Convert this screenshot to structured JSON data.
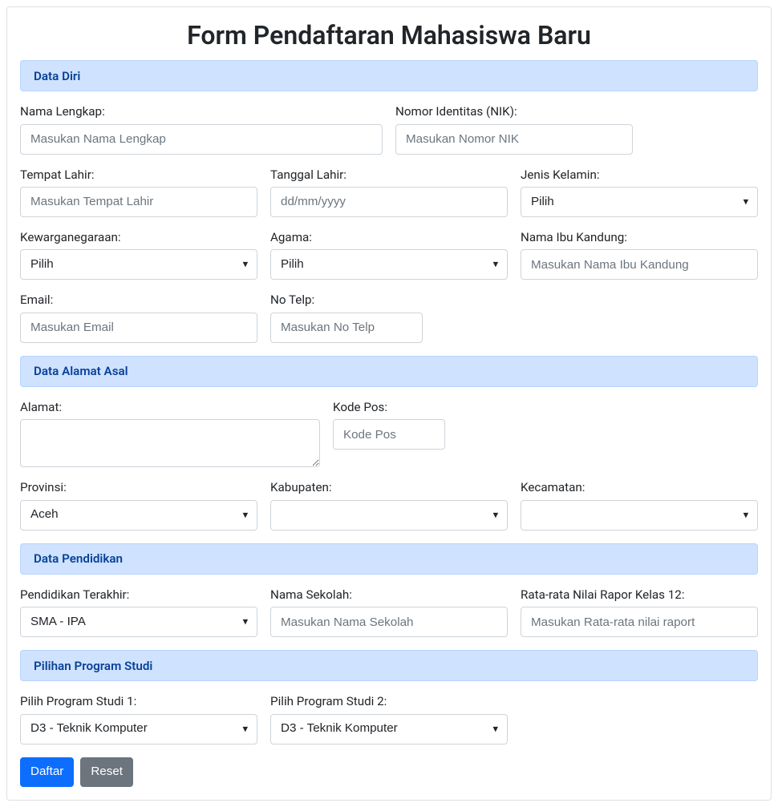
{
  "title": "Form Pendaftaran Mahasiswa Baru",
  "sections": {
    "data_diri": {
      "heading": "Data Diri",
      "nama_lengkap_label": "Nama Lengkap:",
      "nama_lengkap_placeholder": "Masukan Nama Lengkap",
      "nik_label": "Nomor Identitas (NIK):",
      "nik_placeholder": "Masukan Nomor NIK",
      "tempat_lahir_label": "Tempat Lahir:",
      "tempat_lahir_placeholder": "Masukan Tempat Lahir",
      "tanggal_lahir_label": "Tanggal Lahir:",
      "tanggal_lahir_placeholder": "dd/mm/yyyy",
      "jenis_kelamin_label": "Jenis Kelamin:",
      "jenis_kelamin_value": "Pilih",
      "kewarganegaraan_label": "Kewarganegaraan:",
      "kewarganegaraan_value": "Pilih",
      "agama_label": "Agama:",
      "agama_value": "Pilih",
      "nama_ibu_label": "Nama Ibu Kandung:",
      "nama_ibu_placeholder": "Masukan Nama Ibu Kandung",
      "email_label": "Email:",
      "email_placeholder": "Masukan Email",
      "telp_label": "No Telp:",
      "telp_placeholder": "Masukan No Telp"
    },
    "alamat": {
      "heading": "Data Alamat Asal",
      "alamat_label": "Alamat:",
      "kodepos_label": "Kode Pos:",
      "kodepos_placeholder": "Kode Pos",
      "provinsi_label": "Provinsi:",
      "provinsi_value": "Aceh",
      "kabupaten_label": "Kabupaten:",
      "kabupaten_value": "",
      "kecamatan_label": "Kecamatan:",
      "kecamatan_value": ""
    },
    "pendidikan": {
      "heading": "Data Pendidikan",
      "pendidikan_terakhir_label": "Pendidikan Terakhir:",
      "pendidikan_terakhir_value": "SMA - IPA",
      "nama_sekolah_label": "Nama Sekolah:",
      "nama_sekolah_placeholder": "Masukan Nama Sekolah",
      "rapor_label": "Rata-rata Nilai Rapor Kelas 12:",
      "rapor_placeholder": "Masukan Rata-rata nilai raport"
    },
    "prodi": {
      "heading": "Pilihan Program Studi",
      "prodi1_label": "Pilih Program Studi 1:",
      "prodi1_value": "D3 - Teknik Komputer",
      "prodi2_label": "Pilih Program Studi 2:",
      "prodi2_value": "D3 - Teknik Komputer"
    }
  },
  "buttons": {
    "submit": "Daftar",
    "reset": "Reset"
  }
}
